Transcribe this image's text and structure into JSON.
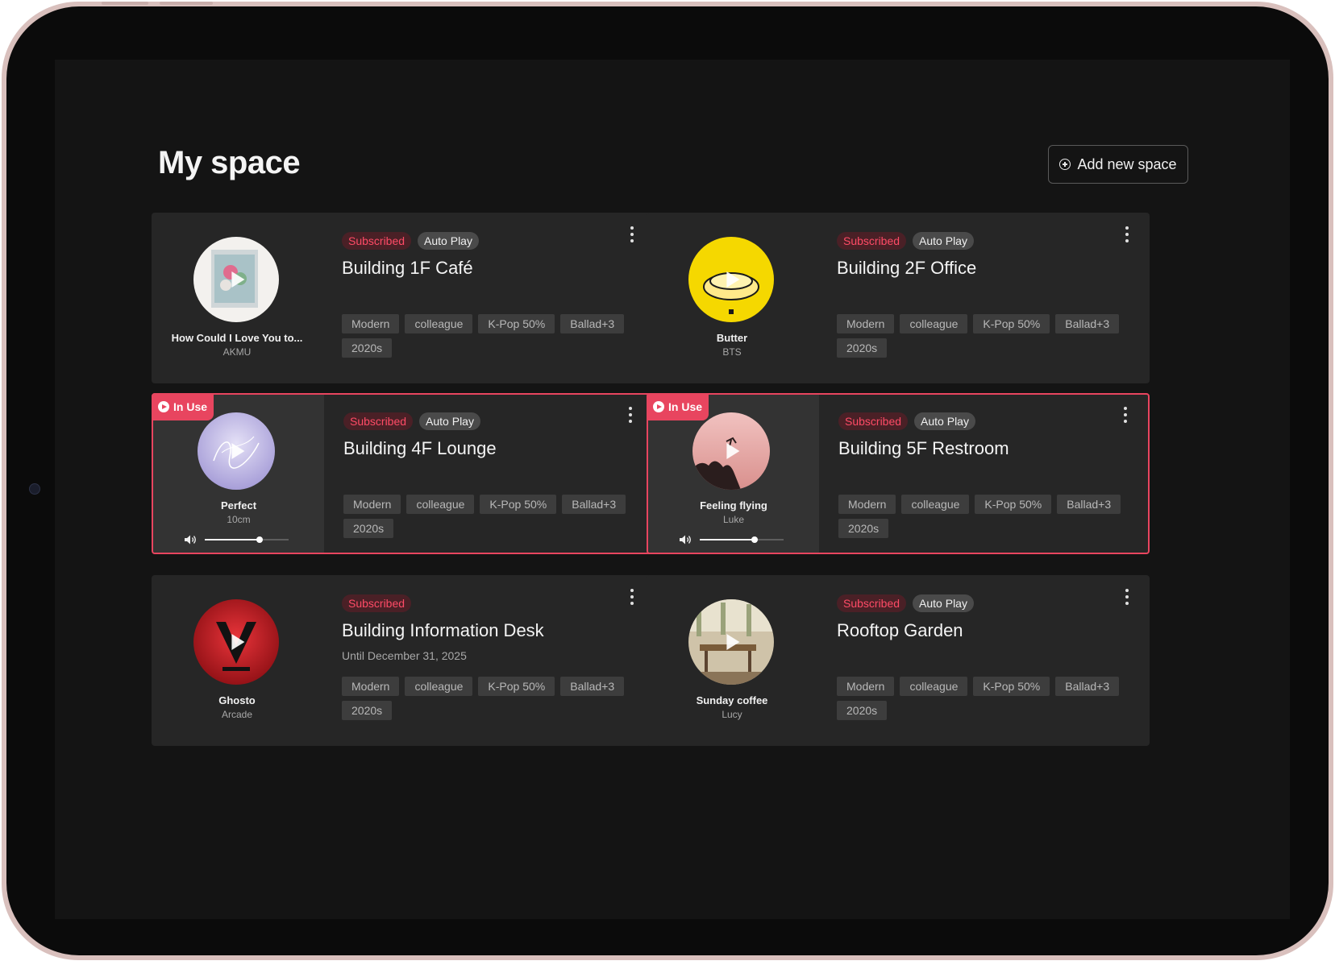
{
  "page": {
    "title": "My space",
    "add_button": "Add new space"
  },
  "colors": {
    "accent": "#e8455f",
    "background": "#141414",
    "card": "#262626"
  },
  "spaces": [
    {
      "name": "Building 1F Café",
      "subscribed": "Subscribed",
      "autoplay": "Auto Play",
      "until": "",
      "song": "How Could I Love You to...",
      "artist": "AKMU",
      "in_use": false,
      "tags": [
        "Modern",
        "colleague",
        "K-Pop 50%",
        "Ballad+3",
        "2020s"
      ]
    },
    {
      "name": "Building 2F Office",
      "subscribed": "Subscribed",
      "autoplay": "Auto Play",
      "until": "",
      "song": "Butter",
      "artist": "BTS",
      "in_use": false,
      "tags": [
        "Modern",
        "colleague",
        "K-Pop 50%",
        "Ballad+3",
        "2020s"
      ]
    },
    {
      "name": "Building 4F Lounge",
      "subscribed": "Subscribed",
      "autoplay": "Auto Play",
      "until": "",
      "song": "Perfect",
      "artist": "10cm",
      "in_use": true,
      "in_use_label": "In Use",
      "volume": 0.65,
      "tags": [
        "Modern",
        "colleague",
        "K-Pop 50%",
        "Ballad+3",
        "2020s"
      ]
    },
    {
      "name": "Building 5F Restroom",
      "subscribed": "Subscribed",
      "autoplay": "Auto Play",
      "until": "",
      "song": "Feeling flying",
      "artist": "Luke",
      "in_use": true,
      "in_use_label": "In Use",
      "volume": 0.65,
      "tags": [
        "Modern",
        "colleague",
        "K-Pop 50%",
        "Ballad+3",
        "2020s"
      ]
    },
    {
      "name": "Building Information Desk",
      "subscribed": "Subscribed",
      "autoplay": "",
      "until": "Until December 31, 2025",
      "song": "Ghosto",
      "artist": "Arcade",
      "in_use": false,
      "tags": [
        "Modern",
        "colleague",
        "K-Pop 50%",
        "Ballad+3",
        "2020s"
      ]
    },
    {
      "name": "Rooftop Garden",
      "subscribed": "Subscribed",
      "autoplay": "Auto Play",
      "until": "",
      "song": "Sunday coffee",
      "artist": "Lucy",
      "in_use": false,
      "tags": [
        "Modern",
        "colleague",
        "K-Pop 50%",
        "Ballad+3",
        "2020s"
      ]
    }
  ]
}
